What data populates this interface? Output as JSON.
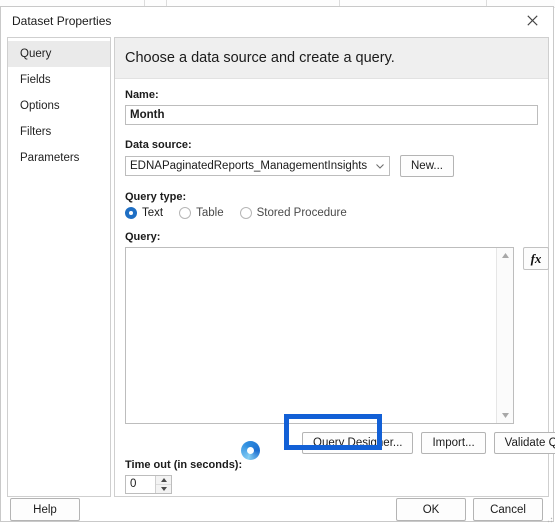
{
  "window": {
    "title": "Dataset Properties",
    "close_icon": "close-icon"
  },
  "sidebar": {
    "items": [
      {
        "label": "Query",
        "selected": true
      },
      {
        "label": "Fields",
        "selected": false
      },
      {
        "label": "Options",
        "selected": false
      },
      {
        "label": "Filters",
        "selected": false
      },
      {
        "label": "Parameters",
        "selected": false
      }
    ]
  },
  "panel": {
    "header": "Choose a data source and create a query.",
    "name": {
      "label": "Name:",
      "value": "Month"
    },
    "data_source": {
      "label": "Data source:",
      "value": "EDNAPaginatedReports_ManagementInsights",
      "chevron_icon": "chevron-down-icon",
      "new_button": "New..."
    },
    "query_type": {
      "label": "Query type:",
      "options": [
        {
          "label": "Text",
          "selected": true
        },
        {
          "label": "Table",
          "selected": false
        },
        {
          "label": "Stored Procedure",
          "selected": false
        }
      ]
    },
    "query": {
      "label": "Query:",
      "value": "",
      "expression_button": "fx",
      "scroll_up_icon": "scroll-up-arrow-icon",
      "scroll_down_icon": "scroll-down-arrow-icon"
    },
    "query_actions": {
      "query_designer": "Query Designer...",
      "import": "Import...",
      "validate": "Validate Query"
    },
    "timeout": {
      "label": "Time out (in seconds):",
      "value": "0",
      "up_icon": "spinner-up-icon",
      "down_icon": "spinner-down-icon"
    }
  },
  "footer": {
    "help": "Help",
    "ok": "OK",
    "cancel": "Cancel"
  },
  "annotation": {
    "target": "Query Designer...",
    "color": "#1260d6"
  },
  "cursor": {
    "type": "busy-ring-cursor",
    "color": "#2f8fe0"
  }
}
